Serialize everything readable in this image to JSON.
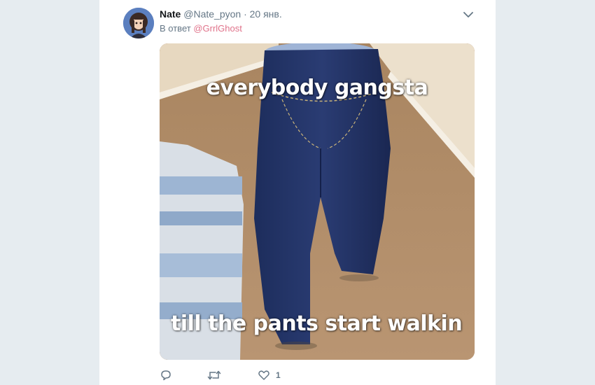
{
  "tweet": {
    "name": "Nate",
    "handle": "@Nate_pyon",
    "separator": "·",
    "date": "20 янв.",
    "reply_prefix": "В ответ",
    "reply_to": "@GrrlGhost",
    "media": {
      "top_text": "everybody gangsta",
      "bottom_text": "till the pants start walkin"
    },
    "actions": {
      "reply_icon": "comment-icon",
      "retweet_icon": "retweet-icon",
      "like_icon": "heart-icon",
      "like_count": "1"
    }
  },
  "colors": {
    "background": "#e6ecf0",
    "mention": "#e0728a",
    "muted": "#657786"
  }
}
